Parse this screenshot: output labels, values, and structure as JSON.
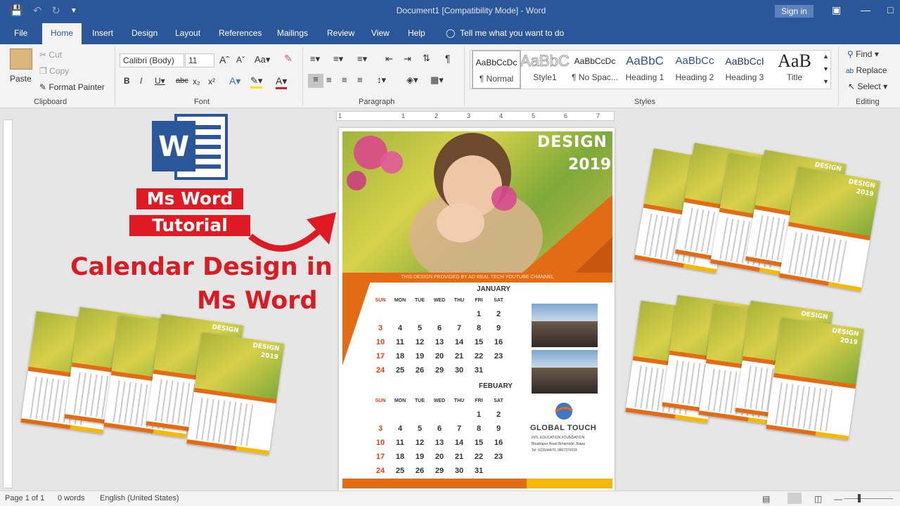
{
  "titlebar": {
    "title": "Document1 [Compatibility Mode]  -  Word",
    "sign_in": "Sign in",
    "qat": {
      "save_icon": "save-icon",
      "undo_icon": "undo-icon",
      "redo_icon": "redo-icon",
      "customize_icon": "customize-qat-icon"
    }
  },
  "tabs": {
    "items": [
      "File",
      "Home",
      "Insert",
      "Design",
      "Layout",
      "References",
      "Mailings",
      "Review",
      "View",
      "Help"
    ],
    "active": "Home",
    "tell_me": "Tell me what you want to do"
  },
  "ribbon": {
    "clipboard": {
      "paste": "Paste",
      "cut": "Cut",
      "copy": "Copy",
      "format_painter": "Format Painter",
      "label": "Clipboard"
    },
    "font": {
      "font_name": "Calibri (Body)",
      "font_size": "11",
      "label": "Font"
    },
    "paragraph": {
      "label": "Paragraph"
    },
    "styles": {
      "label": "Styles",
      "items": [
        {
          "preview": "AaBbCcDc",
          "name": "¶ Normal"
        },
        {
          "preview": "AaBbCc",
          "name": "Style1"
        },
        {
          "preview": "AaBbCcDc",
          "name": "¶ No Spac..."
        },
        {
          "preview": "AaBbC",
          "name": "Heading 1"
        },
        {
          "preview": "AaBbCc",
          "name": "Heading 2"
        },
        {
          "preview": "AaBbCcI",
          "name": "Heading 3"
        },
        {
          "preview": "AaB",
          "name": "Title"
        }
      ]
    },
    "editing": {
      "find": "Find",
      "replace": "Replace",
      "select": "Select",
      "label": "Editing"
    }
  },
  "ruler": {
    "ticks": [
      "1",
      "1",
      "2",
      "3",
      "4",
      "5",
      "6",
      "7"
    ]
  },
  "promo": {
    "badge_line1": "Ms Word",
    "badge_line2": "Tutorial",
    "heading_line1": "Calendar Design in",
    "heading_line2": "Ms Word"
  },
  "calendar_page": {
    "title": "DESIGN",
    "year": "2019",
    "banner": "THIS DESIGN PROVIDED BY AD REAL TECH YOUTUBE CHANNEL",
    "day_headers": [
      "SUN",
      "MON",
      "TUE",
      "WED",
      "THU",
      "FRI",
      "SAT"
    ],
    "months": [
      {
        "name": "JANUARY",
        "weeks": [
          [
            "",
            "",
            "",
            "",
            "",
            "1",
            "2"
          ],
          [
            "3",
            "4",
            "5",
            "6",
            "7",
            "8",
            "9"
          ],
          [
            "10",
            "11",
            "12",
            "13",
            "14",
            "15",
            "16"
          ],
          [
            "17",
            "18",
            "19",
            "20",
            "21",
            "22",
            "23"
          ],
          [
            "24",
            "25",
            "26",
            "29",
            "30",
            "31",
            ""
          ]
        ]
      },
      {
        "name": "FEBUARY",
        "weeks": [
          [
            "",
            "",
            "",
            "",
            "",
            "1",
            "2"
          ],
          [
            "3",
            "4",
            "5",
            "6",
            "7",
            "8",
            "9"
          ],
          [
            "10",
            "11",
            "12",
            "13",
            "14",
            "15",
            "16"
          ],
          [
            "17",
            "18",
            "19",
            "20",
            "21",
            "22",
            "23"
          ],
          [
            "24",
            "25",
            "26",
            "29",
            "30",
            "31",
            ""
          ]
        ]
      }
    ],
    "company": "GLOBAL TOUCH",
    "company_sub": "INTL EDUCATION FOUNDATION",
    "company_addr": "Bhadrapur Road Birtamode Jhapa",
    "company_tel": "Tel: 023544470, 9807370018"
  },
  "thumbs": {
    "label": "DESIGN",
    "year": "2019"
  },
  "statusbar": {
    "page": "Page 1 of 1",
    "words": "0 words",
    "language": "English (United States)"
  },
  "colors": {
    "accent": "#2b579a",
    "brand_red": "#e01a22",
    "orange": "#e26b14",
    "yellow": "#f6b800"
  }
}
